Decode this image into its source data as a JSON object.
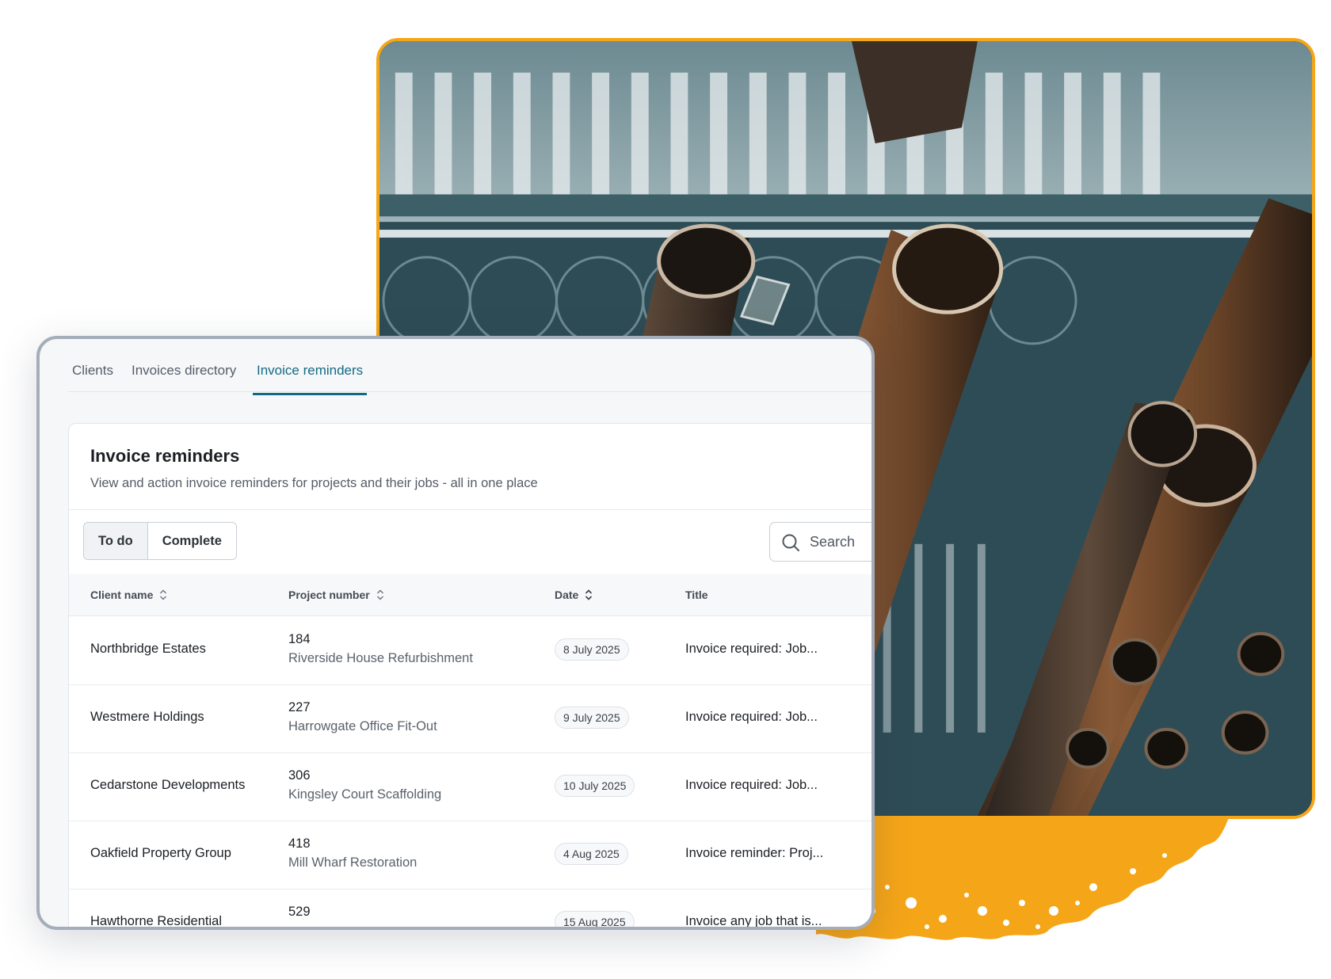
{
  "colors": {
    "accent": "#146a83",
    "brand_orange": "#f5a518",
    "card_border": "#a5adba"
  },
  "tabs": [
    {
      "label": "Clients",
      "active": false
    },
    {
      "label": "Invoices directory",
      "active": false
    },
    {
      "label": "Invoice reminders",
      "active": true
    }
  ],
  "panel": {
    "title": "Invoice reminders",
    "subtitle": "View and action invoice reminders for projects and their jobs - all in one place"
  },
  "filters": {
    "todo_label": "To do",
    "complete_label": "Complete",
    "selected": "To do"
  },
  "search": {
    "placeholder": "Search",
    "icon": "search-icon"
  },
  "table": {
    "columns": [
      "Client name",
      "Project number",
      "Date",
      "Title"
    ],
    "rows": [
      {
        "client": "Northbridge Estates",
        "project_number": "184",
        "project_name": "Riverside House Refurbishment",
        "date": "8 July 2025",
        "title": "Invoice required: Job..."
      },
      {
        "client": "Westmere Holdings",
        "project_number": "227",
        "project_name": "Harrowgate Office Fit-Out",
        "date": "9 July 2025",
        "title": "Invoice required: Job..."
      },
      {
        "client": "Cedarstone Developments",
        "project_number": "306",
        "project_name": "Kingsley Court Scaffolding",
        "date": "10 July 2025",
        "title": "Invoice required: Job..."
      },
      {
        "client": "Oakfield Property Group",
        "project_number": "418",
        "project_name": "Mill Wharf Restoration",
        "date": "4 Aug 2025",
        "title": "Invoice reminder: Proj..."
      },
      {
        "client": "Hawthorne Residential",
        "project_number": "529",
        "project_name": "",
        "date": "15 Aug 2025",
        "title": "Invoice any job that is..."
      }
    ]
  }
}
